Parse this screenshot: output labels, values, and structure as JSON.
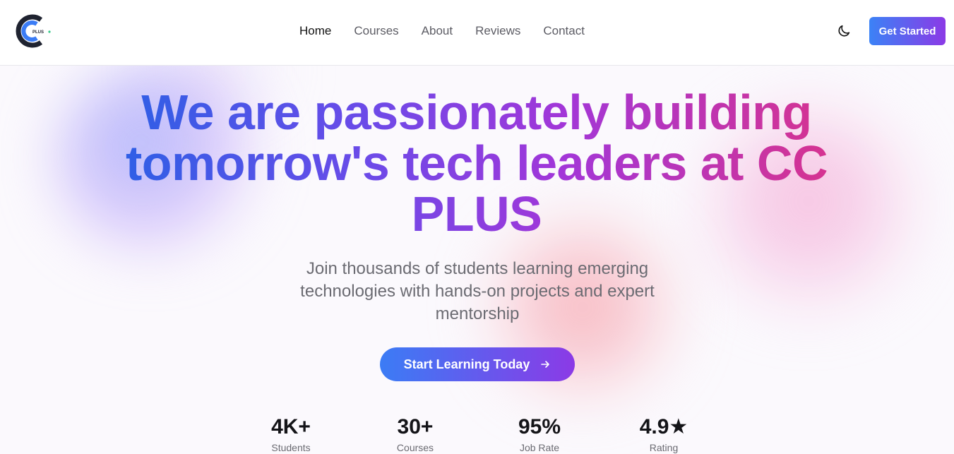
{
  "brand": {
    "logo_text": "PLUS",
    "accent_start": "#3b82f6",
    "accent_end": "#8b3ae6"
  },
  "nav": {
    "items": [
      {
        "label": "Home",
        "active": true
      },
      {
        "label": "Courses",
        "active": false
      },
      {
        "label": "About",
        "active": false
      },
      {
        "label": "Reviews",
        "active": false
      },
      {
        "label": "Contact",
        "active": false
      }
    ],
    "theme_toggle_icon": "moon-icon",
    "cta_label": "Get Started"
  },
  "hero": {
    "headline": "We are passionately building tomorrow's tech leaders at CC PLUS",
    "subtitle": "Join thousands of students learning emerging technologies with hands-on projects and expert mentorship",
    "button_label": "Start Learning Today",
    "button_icon": "arrow-right-icon"
  },
  "stats": [
    {
      "value": "4K+",
      "label": "Students"
    },
    {
      "value": "30+",
      "label": "Courses"
    },
    {
      "value": "95%",
      "label": "Job Rate"
    },
    {
      "value": "4.9★",
      "label": "Rating"
    }
  ]
}
